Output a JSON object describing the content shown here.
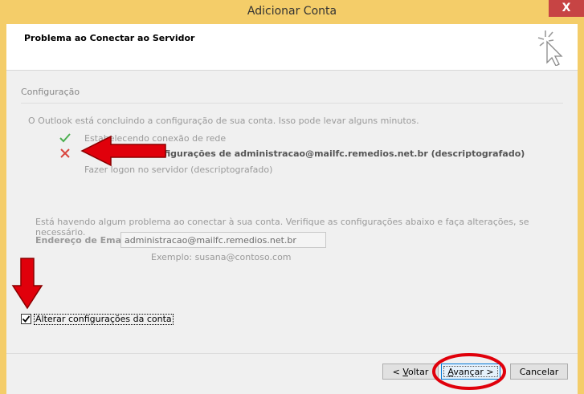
{
  "window": {
    "title": "Adicionar Conta",
    "close_glyph": "X"
  },
  "header": {
    "heading": "Problema ao Conectar ao Servidor"
  },
  "config": {
    "section_label": "Configuração",
    "intro": "O Outlook está concluindo a configuração de sua conta. Isso pode levar alguns minutos.",
    "steps": [
      {
        "status": "success",
        "label": "Estabelecendo conexão de rede"
      },
      {
        "status": "error",
        "label": "figurações de administracao@mailfc.remedios.net.br (descriptografado)"
      },
      {
        "status": "pending",
        "label": "Fazer logon no servidor (descriptografado)"
      }
    ]
  },
  "problem": {
    "text": "Está havendo algum problema ao conectar à sua conta. Verifique as configurações abaixo e faça alterações, se necessário.",
    "email_label": "Endereço de Email:",
    "email_value": "administracao@mailfc.remedios.net.br",
    "example": "Exemplo: susana@contoso.com"
  },
  "options": {
    "change_settings_label": "Alterar configurações da conta",
    "change_settings_checked": true
  },
  "buttons": {
    "back_prefix": "< ",
    "back_key": "V",
    "back_rest": "oltar",
    "next_key": "A",
    "next_rest": "vançar >",
    "cancel": "Cancelar"
  },
  "colors": {
    "titlebar": "#f4cd69",
    "close": "#c74444",
    "annotation_red": "#e0000b",
    "success": "#4caf50",
    "error": "#d9463f"
  }
}
